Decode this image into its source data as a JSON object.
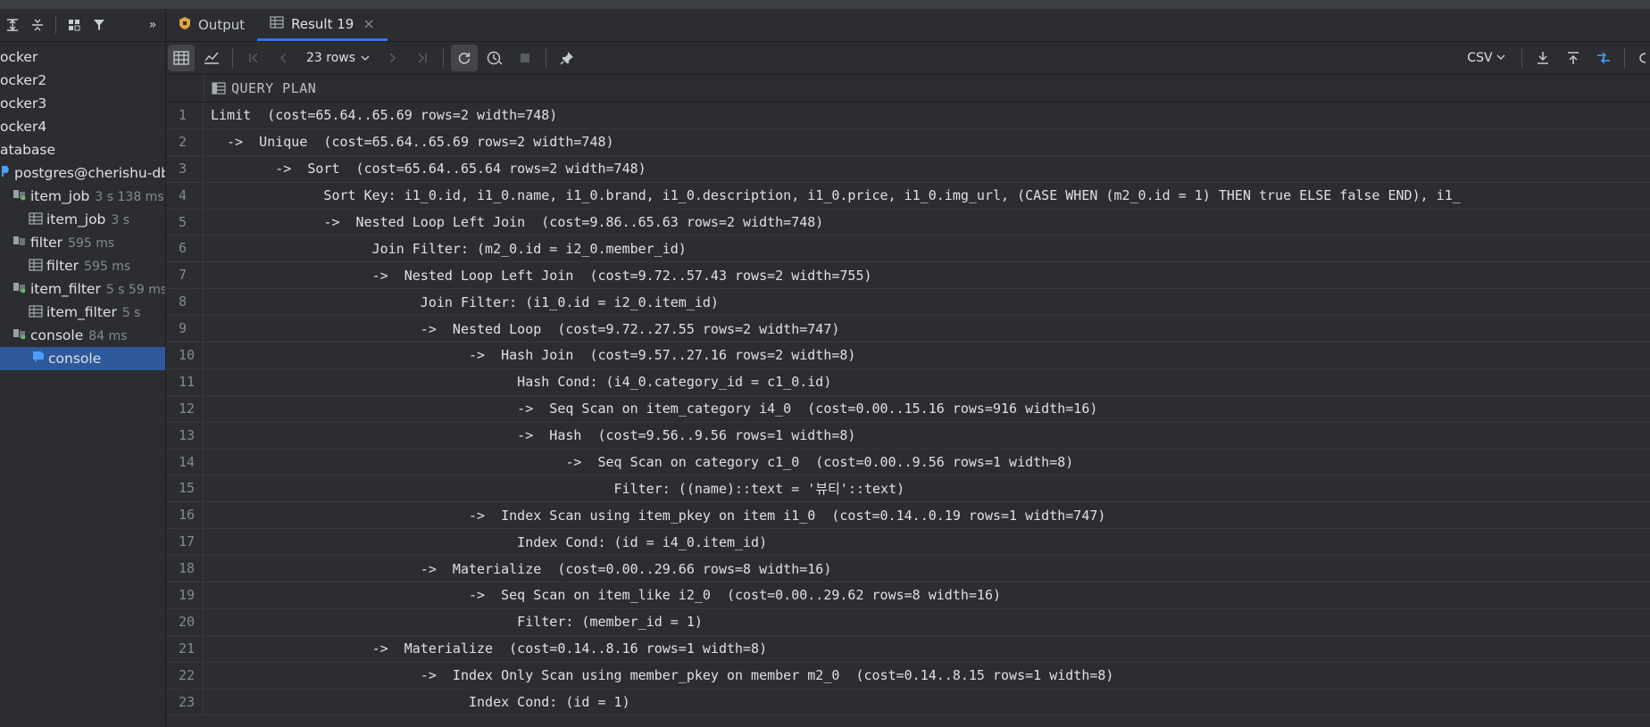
{
  "sidebar": {
    "items": [
      {
        "label": "ocker",
        "meta": "",
        "kind": "text"
      },
      {
        "label": "ocker2",
        "meta": "",
        "kind": "text"
      },
      {
        "label": "ocker3",
        "meta": "",
        "kind": "text"
      },
      {
        "label": "ocker4",
        "meta": "",
        "kind": "text"
      },
      {
        "label": "atabase",
        "meta": "",
        "kind": "text"
      },
      {
        "label": "postgres@cherishu-db.c",
        "meta": "",
        "kind": "datasource"
      },
      {
        "label": "item_job",
        "meta": "3 s 138 ms",
        "kind": "session"
      },
      {
        "label": "item_job",
        "meta": "3 s",
        "kind": "table"
      },
      {
        "label": "filter",
        "meta": "595 ms",
        "kind": "session"
      },
      {
        "label": "filter",
        "meta": "595 ms",
        "kind": "table"
      },
      {
        "label": "item_filter",
        "meta": "5 s 59 ms",
        "kind": "session"
      },
      {
        "label": "item_filter",
        "meta": "5 s",
        "kind": "table"
      },
      {
        "label": "console",
        "meta": "84 ms",
        "kind": "session"
      },
      {
        "label": "console",
        "meta": "",
        "kind": "console"
      }
    ]
  },
  "tabs": [
    {
      "label": "Output",
      "active": false
    },
    {
      "label": "Result 19",
      "active": true
    }
  ],
  "toolbar": {
    "rows_label": "23 rows",
    "export_format": "CSV"
  },
  "grid": {
    "column_header": "QUERY PLAN",
    "rows": [
      {
        "n": "1",
        "text": "Limit  (cost=65.64..65.69 rows=2 width=748)"
      },
      {
        "n": "2",
        "text": "  ->  Unique  (cost=65.64..65.69 rows=2 width=748)"
      },
      {
        "n": "3",
        "text": "        ->  Sort  (cost=65.64..65.64 rows=2 width=748)"
      },
      {
        "n": "4",
        "text": "              Sort Key: i1_0.id, i1_0.name, i1_0.brand, i1_0.description, i1_0.price, i1_0.img_url, (CASE WHEN (m2_0.id = 1) THEN true ELSE false END), i1_"
      },
      {
        "n": "5",
        "text": "              ->  Nested Loop Left Join  (cost=9.86..65.63 rows=2 width=748)"
      },
      {
        "n": "6",
        "text": "                    Join Filter: (m2_0.id = i2_0.member_id)"
      },
      {
        "n": "7",
        "text": "                    ->  Nested Loop Left Join  (cost=9.72..57.43 rows=2 width=755)"
      },
      {
        "n": "8",
        "text": "                          Join Filter: (i1_0.id = i2_0.item_id)"
      },
      {
        "n": "9",
        "text": "                          ->  Nested Loop  (cost=9.72..27.55 rows=2 width=747)"
      },
      {
        "n": "10",
        "text": "                                ->  Hash Join  (cost=9.57..27.16 rows=2 width=8)"
      },
      {
        "n": "11",
        "text": "                                      Hash Cond: (i4_0.category_id = c1_0.id)"
      },
      {
        "n": "12",
        "text": "                                      ->  Seq Scan on item_category i4_0  (cost=0.00..15.16 rows=916 width=16)"
      },
      {
        "n": "13",
        "text": "                                      ->  Hash  (cost=9.56..9.56 rows=1 width=8)"
      },
      {
        "n": "14",
        "text": "                                            ->  Seq Scan on category c1_0  (cost=0.00..9.56 rows=1 width=8)"
      },
      {
        "n": "15",
        "text": "                                                  Filter: ((name)::text = '뷰티'::text)"
      },
      {
        "n": "16",
        "text": "                                ->  Index Scan using item_pkey on item i1_0  (cost=0.14..0.19 rows=1 width=747)"
      },
      {
        "n": "17",
        "text": "                                      Index Cond: (id = i4_0.item_id)"
      },
      {
        "n": "18",
        "text": "                          ->  Materialize  (cost=0.00..29.66 rows=8 width=16)"
      },
      {
        "n": "19",
        "text": "                                ->  Seq Scan on item_like i2_0  (cost=0.00..29.62 rows=8 width=16)"
      },
      {
        "n": "20",
        "text": "                                      Filter: (member_id = 1)"
      },
      {
        "n": "21",
        "text": "                    ->  Materialize  (cost=0.14..8.16 rows=1 width=8)"
      },
      {
        "n": "22",
        "text": "                          ->  Index Only Scan using member_pkey on member m2_0  (cost=0.14..8.15 rows=1 width=8)"
      },
      {
        "n": "23",
        "text": "                                Index Cond: (id = 1)"
      }
    ]
  },
  "colors": {
    "accent": "#3574f0",
    "selected_row": "#2e5a9b",
    "background": "#2b2d30"
  }
}
